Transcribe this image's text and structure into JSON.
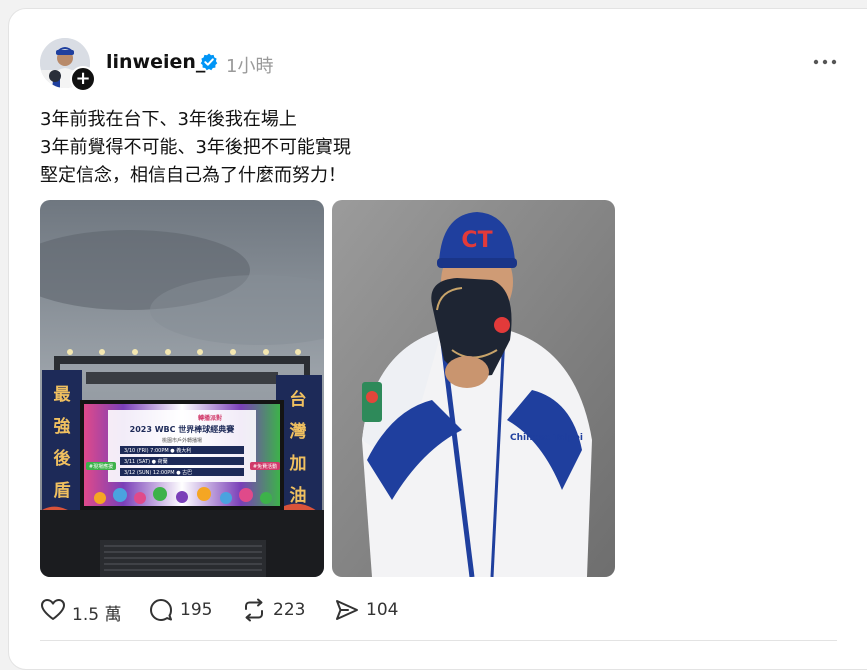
{
  "post": {
    "username": "linweien_",
    "timestamp": "1小時",
    "caption": [
      "3年前我在台下、3年後我在場上",
      "3年前覺得不可能、3年後把不可能實現",
      "堅定信念，相信自己為了什麼而努力！"
    ]
  },
  "photo1": {
    "banner_left": [
      "最",
      "強",
      "後",
      "盾"
    ],
    "banner_right": [
      "台",
      "灣",
      "加",
      "油"
    ],
    "screen_title": "2023 WBC 世界棒球經典賽",
    "screen_header": "轉播派對",
    "screen_subtitle": "桃園市戶外轉播場",
    "schedule": [
      "3/10 (FRI) 7:00PM ● 義大利",
      "3/11 (SAT)       ● 荷蘭",
      "3/12 (SUN) 12:00PM ● 古巴"
    ],
    "tag_left": "#現場應援",
    "tag_right": "#免費活動"
  },
  "photo2": {
    "cap_logo": "CT",
    "jersey_text": "Chinese Taipei"
  },
  "actions": {
    "likes": "1.5 萬",
    "comments": "195",
    "reposts": "223",
    "shares": "104"
  },
  "colors": {
    "verified": "#0095f6",
    "muted": "#9a9a9a",
    "royal_blue": "#1f3f9e"
  }
}
